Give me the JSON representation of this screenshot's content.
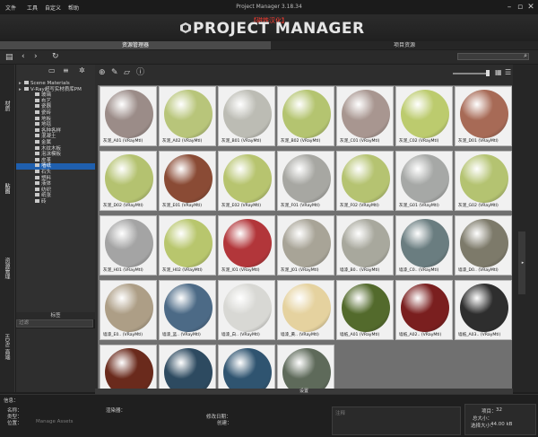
{
  "menu": [
    "文件",
    "工具",
    "帮助"
  ],
  "menu_extra": "自定义",
  "window": {
    "title": "Project Manager 3.18.34"
  },
  "banner": {
    "subtitle": "【磁铁汉化】",
    "product": "PROJECT MANAGER",
    "ghost": "KSTUDIO"
  },
  "tabs": {
    "assets": "资源管理器",
    "project": "项目资源"
  },
  "search": {
    "placeholder": ""
  },
  "vtabs": [
    "材质",
    "贴图",
    "资源管理",
    "HDRI 高端"
  ],
  "tree": {
    "items": [
      {
        "label": "Scene Materials",
        "indent": 0
      },
      {
        "label": "V-Ray超写实材质库PM",
        "indent": 0
      },
      {
        "label": "玻璃",
        "indent": 1
      },
      {
        "label": "布艺",
        "indent": 1
      },
      {
        "label": "瓷器",
        "indent": 1
      },
      {
        "label": "瓷砖",
        "indent": 1
      },
      {
        "label": "地板",
        "indent": 1
      },
      {
        "label": "地毯",
        "indent": 1
      },
      {
        "label": "各种各样",
        "indent": 1
      },
      {
        "label": "混凝土",
        "indent": 1
      },
      {
        "label": "金属",
        "indent": 1
      },
      {
        "label": "木纹木板",
        "indent": 1
      },
      {
        "label": "泡沫模板",
        "indent": 1
      },
      {
        "label": "皮革",
        "indent": 1
      },
      {
        "label": "墙纸",
        "indent": 1
      },
      {
        "label": "石头",
        "indent": 1
      },
      {
        "label": "塑料",
        "indent": 1
      },
      {
        "label": "液体",
        "indent": 1
      },
      {
        "label": "纺织",
        "indent": 1
      },
      {
        "label": "纸张",
        "indent": 1
      },
      {
        "label": "砖",
        "indent": 1
      }
    ],
    "selected_index": 14,
    "footer": "标签",
    "filter_placeholder": "过滤"
  },
  "cards": [
    {
      "label": "灰泥_A01 (VRayMtl)",
      "color": "#9b8c88"
    },
    {
      "label": "灰泥_A02 (VRayMtl)",
      "color": "#b8c57a"
    },
    {
      "label": "灰泥_B01 (VRayMtl)",
      "color": "#bcbcb4"
    },
    {
      "label": "灰泥_B02 (VRayMtl)",
      "color": "#b4c470"
    },
    {
      "label": "灰泥_C01 (VRayMtl)",
      "color": "#a89690"
    },
    {
      "label": "灰泥_C02 (VRayMtl)",
      "color": "#bccb6e"
    },
    {
      "label": "灰泥_D01 (VRayMtl)",
      "color": "#a76a56"
    },
    {
      "label": "灰泥_D02 (VRayMtl)",
      "color": "#b4c270"
    },
    {
      "label": "灰泥_E01 (VRayMtl)",
      "color": "#8a4b35"
    },
    {
      "label": "灰泥_E02 (VRayMtl)",
      "color": "#b7c46f"
    },
    {
      "label": "灰泥_F01 (VRayMtl)",
      "color": "#a7a7a2"
    },
    {
      "label": "灰泥_F02 (VRayMtl)",
      "color": "#b5c371"
    },
    {
      "label": "灰泥_G01 (VRayMtl)",
      "color": "#a6a8a6"
    },
    {
      "label": "灰泥_G02 (VRayMtl)",
      "color": "#b4c371"
    },
    {
      "label": "灰泥_H01 (VRayMtl)",
      "color": "#a4a4a4"
    },
    {
      "label": "灰泥_H02 (VRayMtl)",
      "color": "#b8c66d"
    },
    {
      "label": "灰泥_I01 (VRayMtl)",
      "color": "#b2363a"
    },
    {
      "label": "灰泥_J01 (VRayMtl)",
      "color": "#a8a497"
    },
    {
      "label": "墙漆_B0.. (VRayMtl)",
      "color": "#a8a89d"
    },
    {
      "label": "墙漆_C0.. (VRayMtl)",
      "color": "#6a7d80"
    },
    {
      "label": "墙漆_D0.. (VRayMtl)",
      "color": "#7d7a6a"
    },
    {
      "label": "墙漆_E0.. (VRayMtl)",
      "color": "#ad9e86"
    },
    {
      "label": "墙漆_蓝.. (VRayMtl)",
      "color": "#4c6a86"
    },
    {
      "label": "墙漆_白.. (VRayMtl)",
      "color": "#d8d8d4"
    },
    {
      "label": "墙漆_黄.. (VRayMtl)",
      "color": "#e5d29f"
    },
    {
      "label": "墙纸_A01 (VRayMtl)",
      "color": "#536a2c"
    },
    {
      "label": "墙纸_A02.. (VRayMtl)",
      "color": "#7a1f1f"
    },
    {
      "label": "墙纸_A03.. (VRayMtl)",
      "color": "#2e2e2e"
    },
    {
      "label": "墙纸_B01 (VRayMtl)",
      "color": "#6a2a1c"
    },
    {
      "label": "墙纸_B02 (VRayMtl)",
      "color": "#2d4a60"
    },
    {
      "label": "墙纸_B03 (VRayMtl)",
      "color": "#2f5470"
    },
    {
      "label": "墙纸_C01 (VRayMtl)",
      "color": "#5e6a5a"
    }
  ],
  "bottom": {
    "settings": "设置",
    "info_label": "信息：",
    "name_label": "名称：",
    "type_label": "类型：",
    "path_label": "位置：",
    "path_value": "Manage Assets",
    "renderer_label": "渲染器：",
    "mod_label": "修改日期：",
    "created_label": "创建：",
    "note_label": "注释",
    "stats": {
      "count_label": "项目：",
      "count": "32",
      "size_label": "总大小：",
      "size": "44.00 kB",
      "selected_label": "选择大小："
    }
  }
}
